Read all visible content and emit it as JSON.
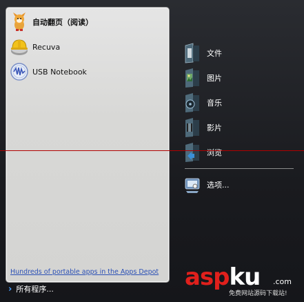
{
  "pinned_apps": [
    {
      "label": "自动翻页（阅读）",
      "icon": "fox-character-icon"
    },
    {
      "label": "Recuva",
      "icon": "hard-hat-disk-icon"
    },
    {
      "label": "USB Notebook",
      "icon": "usb-notebook-icon"
    }
  ],
  "apps_depot_link": "Hundreds of portable apps in the Apps Depot",
  "all_programs": "所有程序...",
  "right_menu": [
    {
      "label": "文件",
      "icon": "documents-folder-icon"
    },
    {
      "label": "图片",
      "icon": "pictures-folder-icon"
    },
    {
      "label": "音乐",
      "icon": "music-folder-icon"
    },
    {
      "label": "影片",
      "icon": "videos-folder-icon"
    },
    {
      "label": "浏览",
      "icon": "explore-folder-icon"
    },
    {
      "label": "选项...",
      "icon": "options-icon"
    }
  ],
  "watermark": {
    "brand_part1": "asp",
    "brand_part2": "ku",
    "suffix": ".com",
    "tagline": "免费网站源码下载站!"
  },
  "colors": {
    "link": "#2a4fb5",
    "watermark_red": "#e0201c",
    "background": "#1b1d20"
  }
}
